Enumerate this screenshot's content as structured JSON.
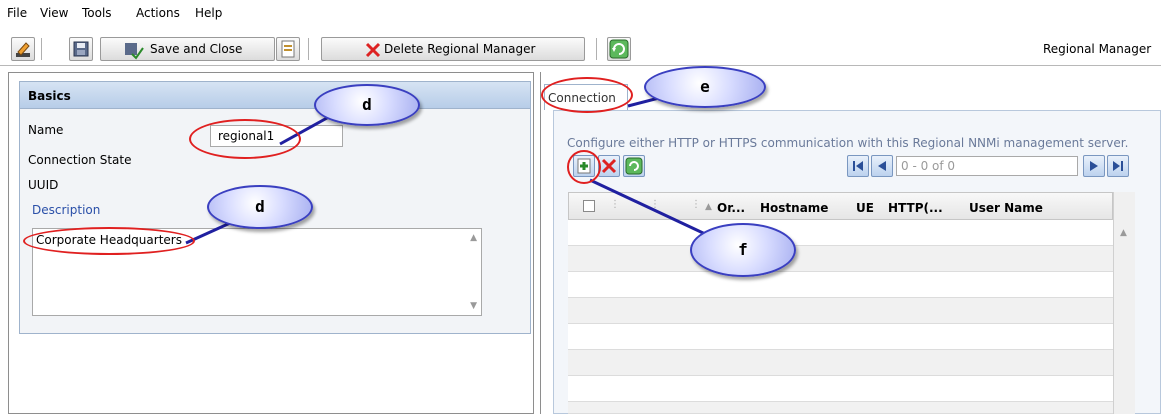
{
  "menu": {
    "items": [
      {
        "label": "File"
      },
      {
        "label": "View"
      },
      {
        "label": "Tools"
      },
      {
        "label": "Actions"
      },
      {
        "label": "Help"
      }
    ]
  },
  "toolbar": {
    "save_close_label": "Save and Close",
    "delete_label": "Delete Regional Manager",
    "form_title": "Regional Manager"
  },
  "basics": {
    "header": "Basics",
    "name_label": "Name",
    "name_value": "regional1",
    "connection_state_label": "Connection State",
    "uuid_label": "UUID",
    "description_label": "Description",
    "description_value": "Corporate Headquarters"
  },
  "connection": {
    "tab_label": "Connection",
    "instructions": "Configure either HTTP or HTTPS communication with this Regional NNMi management server.",
    "page_indicator": "0 - 0 of 0",
    "columns": [
      {
        "label": "Or..."
      },
      {
        "label": "Hostname"
      },
      {
        "label": "UE"
      },
      {
        "label": "HTTP(..."
      },
      {
        "label": "User Name"
      }
    ]
  },
  "callouts": {
    "name_callout": "d",
    "description_callout": "d",
    "tab_callout": "e",
    "new_callout": "f"
  },
  "colors": {
    "callout_fill": "#c8ccf8",
    "callout_border": "#3a3fc0",
    "highlight": "#e02020",
    "header_blue": "#c4d7ee"
  }
}
